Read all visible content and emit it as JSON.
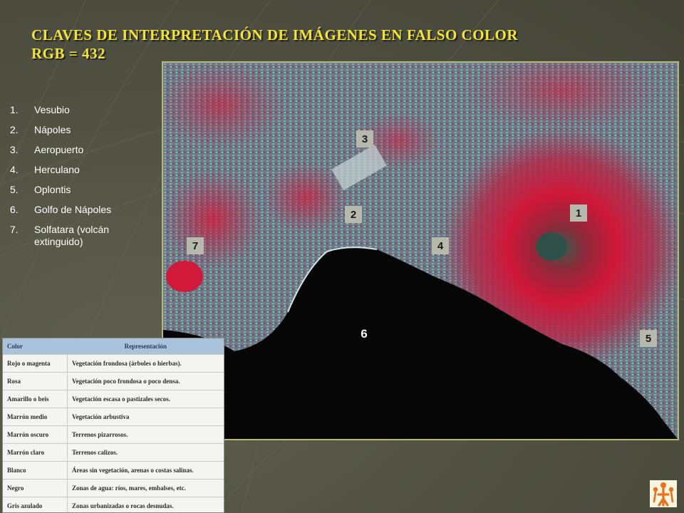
{
  "title": {
    "line1": "CLAVES DE INTERPRETACIÓN DE IMÁGENES EN FALSO COLOR",
    "line2": "RGB = 432"
  },
  "legend": [
    {
      "num": "1.",
      "label": "Vesubio"
    },
    {
      "num": "2.",
      "label": "Nápoles"
    },
    {
      "num": "3.",
      "label": "Aeropuerto"
    },
    {
      "num": "4.",
      "label": "Herculano"
    },
    {
      "num": "5.",
      "label": "Oplontis"
    },
    {
      "num": "6.",
      "label": "Golfo de Nápoles"
    },
    {
      "num": "7.",
      "label": "Solfatara (volcán extinguido)"
    }
  ],
  "map_markers": [
    "1",
    "2",
    "3",
    "4",
    "5",
    "6",
    "7"
  ],
  "color_table": {
    "headers": [
      "Color",
      "Representación"
    ],
    "rows": [
      [
        "Rojo o magenta",
        "Vegetación frondosa (árboles o hierbas)."
      ],
      [
        "Rosa",
        "Vegetación poco frondosa o poco densa."
      ],
      [
        "Amarillo o beis",
        "Vegetación escasa o pastizales secos."
      ],
      [
        "Marrón medio",
        "Vegetación arbustiva"
      ],
      [
        "Marrón oscuro",
        "Terrenos pizarrosos."
      ],
      [
        "Marrón claro",
        "Terrenos calizos."
      ],
      [
        "Blanco",
        "Áreas sin vegetación, arenas o costas salinas."
      ],
      [
        "Negro",
        "Zonas de agua: ríos, mares, embalses, etc."
      ],
      [
        "Gris azulado",
        "Zonas urbanizadas o rocas desnudas."
      ]
    ]
  },
  "colors": {
    "title": "#f2e33a",
    "background": "#4f5042",
    "vegetation_red": "#c8102e",
    "urban_cyan": "#6fb6b8",
    "water": "#070708",
    "table_header": "#a9c3dc",
    "map_border": "#b8b87a",
    "logo": "#e8701a"
  }
}
